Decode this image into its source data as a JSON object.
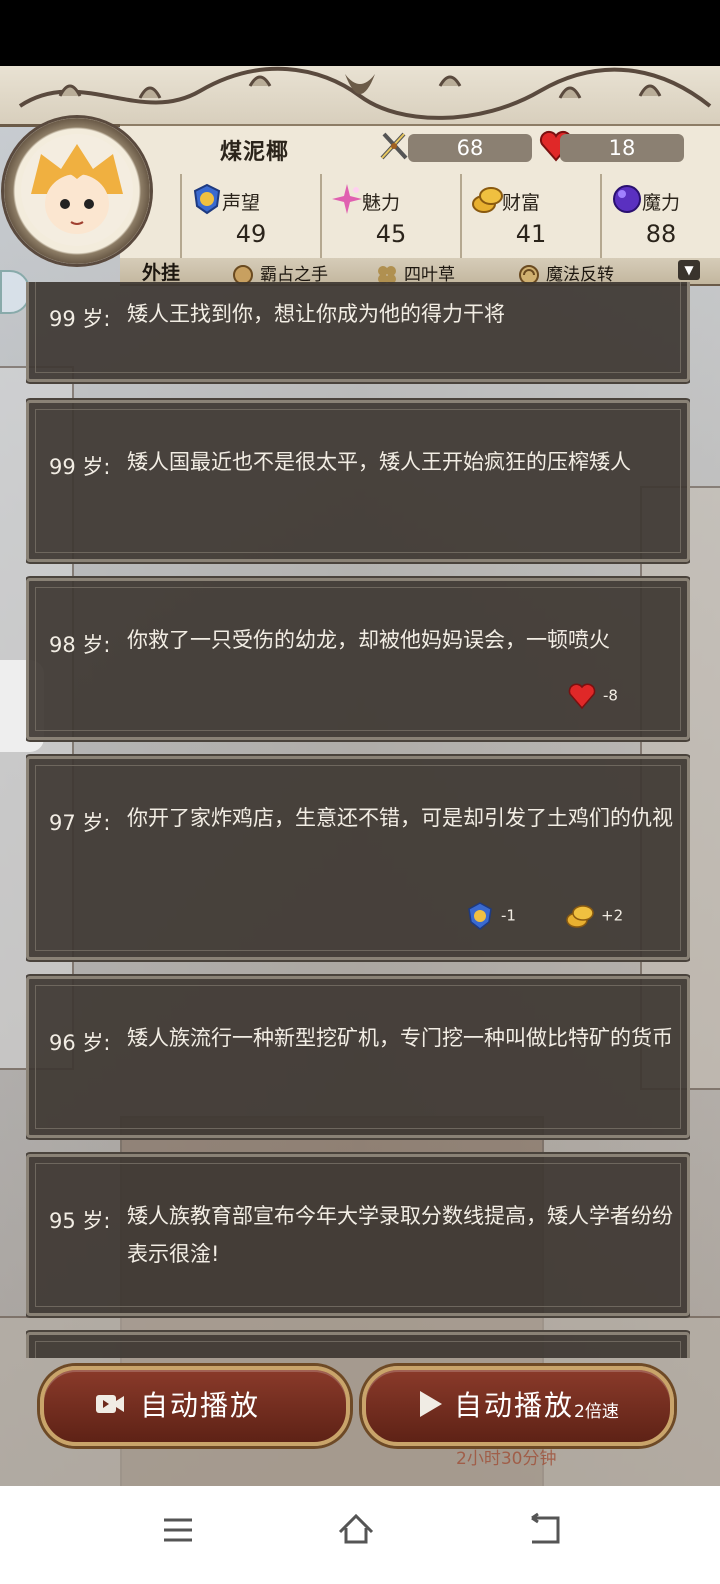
{
  "player": {
    "name": "煤泥椰",
    "attack": "68",
    "health": "18"
  },
  "stats": [
    {
      "label": "声望",
      "value": "49",
      "icon": "reputation-badge-icon"
    },
    {
      "label": "魅力",
      "value": "45",
      "icon": "charm-sparkle-icon"
    },
    {
      "label": "财富",
      "value": "41",
      "icon": "coins-icon"
    },
    {
      "label": "魔力",
      "value": "88",
      "icon": "magic-orb-icon"
    }
  ],
  "cheats": {
    "title": "外挂",
    "items": [
      {
        "label": "霸占之手",
        "icon": "grab-hand-icon"
      },
      {
        "label": "四叶草",
        "icon": "clover-icon"
      },
      {
        "label": "魔法反转",
        "icon": "magic-reverse-icon"
      }
    ]
  },
  "log": [
    {
      "age": "99 岁:",
      "text": "矮人王找到你，想让你成为他的得力干将",
      "effects": []
    },
    {
      "age": "99 岁:",
      "text": "矮人国最近也不是很太平，矮人王开始疯狂的压榨矮人",
      "effects": []
    },
    {
      "age": "98 岁:",
      "text": "你救了一只受伤的幼龙，却被他妈妈误会，一顿喷火",
      "effects": [
        {
          "icon": "heart-icon",
          "value": "-8"
        }
      ]
    },
    {
      "age": "97 岁:",
      "text": "你开了家炸鸡店，生意还不错，可是却引发了土鸡们的仇视",
      "effects": [
        {
          "icon": "reputation-badge-icon",
          "value": "-1"
        },
        {
          "icon": "coins-icon",
          "value": "+2"
        }
      ]
    },
    {
      "age": "96 岁:",
      "text": "矮人族流行一种新型挖矿机，专门挖一种叫做比特矿的货币",
      "effects": []
    },
    {
      "age": "95 岁:",
      "text": "矮人族教育部宣布今年大学录取分数线提高，矮人学者纷纷表示很淦!",
      "effects": []
    }
  ],
  "buttons": {
    "autoplay_video": "自动播放",
    "autoplay_2x": "自动播放",
    "speed": "2倍速",
    "note": "2小时30分钟"
  },
  "colors": {
    "card_bg": "#3e3732",
    "button_red": "#8a3a2a",
    "gold_border": "#c9a46a",
    "heart_red": "#e02828"
  }
}
